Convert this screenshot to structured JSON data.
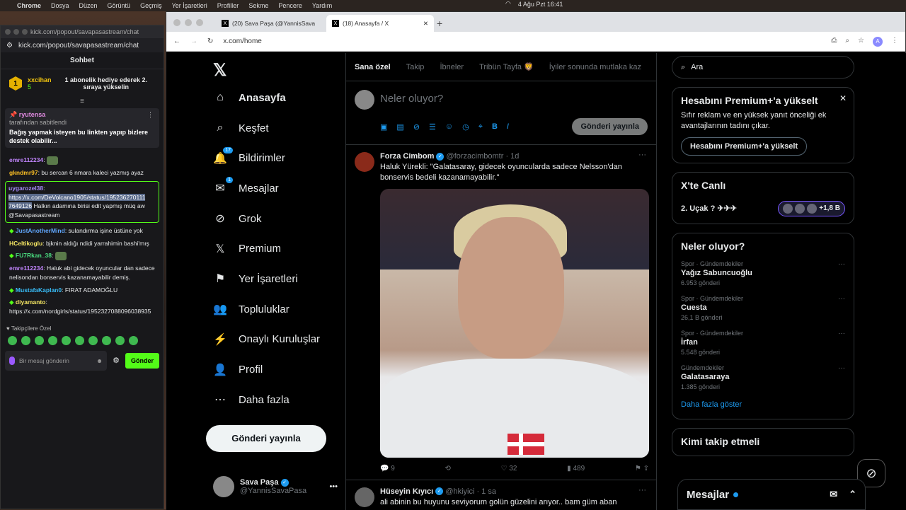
{
  "menubar": {
    "app": "Chrome",
    "items": [
      "Dosya",
      "Düzen",
      "Görüntü",
      "Geçmiş",
      "Yer İşaretleri",
      "Profiller",
      "Sekme",
      "Pencere",
      "Yardım"
    ],
    "clock": "4 Ağu Pzt  16:41"
  },
  "chat": {
    "url": "kick.com/popout/savapasastream/chat",
    "header": "Sohbet",
    "gift": {
      "user": "xxcihan",
      "count": "5",
      "rank": "1",
      "text": "1 abonelik hediye ederek 2. sıraya yükselin"
    },
    "pinned": {
      "user": "ryutensa",
      "sub": "tarafından sabitlendi",
      "text": "Bağış yapmak isteyen bu linkten yapıp bizlere destek olabilir..."
    },
    "messages": [
      {
        "user": "emre112234",
        "text": ""
      },
      {
        "user": "gkndmr97",
        "text": "bu sercan 6 nmara kaleci yazmış ayaz"
      },
      {
        "user": "uygarozel38",
        "sel": "https://x.com/DeVolcano1905/status/195236270111 7649126",
        "text": "Halkın adamına birisi edit yapmış müq aw @Savapasastream"
      },
      {
        "user": "JustAnotherMind",
        "text": "sulandırma işine üstüne yok"
      },
      {
        "user": "HCeltikoglu",
        "text": "bjknin aldığı ndidi yarrahimin bashi'mış"
      },
      {
        "user": "FU7Rkan_38",
        "text": ""
      },
      {
        "user": "emre112234",
        "text": "Haluk abi gidecek oyuncular dan sadece nelisondan bonservis kazanamayabilir demiş."
      },
      {
        "user": "MustafaKaplan0",
        "text": "FIRAT ADAMOĞLU"
      },
      {
        "user": "diyamanto",
        "text": "https://x.com/nordgirls/status/1952327088096038935"
      }
    ],
    "followers_label": "Takipçilere Özel",
    "input_placeholder": "Bir mesaj gönderin",
    "send": "Gönder"
  },
  "browser": {
    "tabs": [
      {
        "label": "(20) Sava Paşa (@YannisSava"
      },
      {
        "label": "(18) Anasayfa / X"
      }
    ],
    "url": "x.com/home"
  },
  "nav": {
    "items": [
      {
        "label": "Anasayfa",
        "icon": "home-icon",
        "glyph": "⌂",
        "badge": ""
      },
      {
        "label": "Keşfet",
        "icon": "search-icon",
        "glyph": "⌕",
        "badge": ""
      },
      {
        "label": "Bildirimler",
        "icon": "bell-icon",
        "glyph": "🔔",
        "badge": "17"
      },
      {
        "label": "Mesajlar",
        "icon": "mail-icon",
        "glyph": "✉",
        "badge": "1"
      },
      {
        "label": "Grok",
        "icon": "grok-icon",
        "glyph": "⊘",
        "badge": ""
      },
      {
        "label": "Premium",
        "icon": "x-icon",
        "glyph": "𝕏",
        "badge": ""
      },
      {
        "label": "Yer İşaretleri",
        "icon": "bookmark-icon",
        "glyph": "⚑",
        "badge": ""
      },
      {
        "label": "Topluluklar",
        "icon": "people-icon",
        "glyph": "👥",
        "badge": ""
      },
      {
        "label": "Onaylı Kuruluşlar",
        "icon": "lightning-icon",
        "glyph": "⚡",
        "badge": ""
      },
      {
        "label": "Profil",
        "icon": "person-icon",
        "glyph": "👤",
        "badge": ""
      },
      {
        "label": "Daha fazla",
        "icon": "more-icon",
        "glyph": "⋯",
        "badge": ""
      }
    ],
    "post": "Gönderi yayınla",
    "me": {
      "name": "Sava Paşa",
      "handle": "@YannisSavaPasa"
    }
  },
  "timeline": {
    "tabs": [
      "Sana özel",
      "Takip",
      "İbneler",
      "Tribün Tayfa 🦁",
      "İyiler sonunda mutlaka kaz"
    ],
    "compose_placeholder": "Neler oluyor?",
    "post": "Gönderi yayınla",
    "tweets": [
      {
        "name": "Forza Cimbom",
        "handle": "@forzacimbomtr",
        "time": "· 1d",
        "text": "Haluk Yürekli: \"Galatasaray, gidecek oyuncularda sadece Nelsson'dan bonservis bedeli kazanamayabilir.\"",
        "replies": "9",
        "likes": "32",
        "views": "489"
      },
      {
        "name": "Hüseyin Kıyıcı",
        "handle": "@hkiyici",
        "time": "· 1 sa",
        "text": "ali abinin bu huyunu seviyorum golün güzelini arıyor.. bam güm aban"
      }
    ]
  },
  "right": {
    "search": "Ara",
    "premium": {
      "title": "Hesabını Premium+'a yükselt",
      "text": "Sıfır reklam ve en yüksek yanıt önceliği ek avantajlarının tadını çıkar.",
      "btn": "Hesabını Premium+'a yükselt"
    },
    "live": {
      "title": "X'te Canlı",
      "item": "2. Uçak ? ✈✈✈",
      "count": "+1,8 B"
    },
    "trends": {
      "title": "Neler oluyor?",
      "items": [
        {
          "cat": "Spor · Gündemdekiler",
          "name": "Yağız Sabuncuoğlu",
          "count": "6.953 gönderi"
        },
        {
          "cat": "Spor · Gündemdekiler",
          "name": "Cuesta",
          "count": "26,1 B gönderi"
        },
        {
          "cat": "Spor · Gündemdekiler",
          "name": "İrfan",
          "count": "5.548 gönderi"
        },
        {
          "cat": "Gündemdekiler",
          "name": "Galatasaraya",
          "count": "1.385 gönderi"
        }
      ],
      "more": "Daha fazla göster"
    },
    "follow_title": "Kimi takip etmeli",
    "messages": "Mesajlar"
  }
}
